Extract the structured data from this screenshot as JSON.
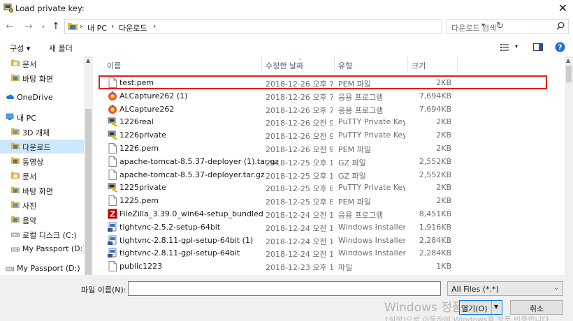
{
  "window": {
    "title": "Load private key:",
    "close": "✕"
  },
  "address": {
    "crumbs": [
      "내 PC",
      "다운로드"
    ],
    "search_placeholder": "다운로드 검색"
  },
  "toolbar": {
    "organize": "구성 ▾",
    "new_folder": "새 폴더"
  },
  "nav": [
    {
      "label": "문서",
      "icon": "document-folder-icon",
      "indent": 30
    },
    {
      "label": "바탕 화면",
      "icon": "desktop-folder-icon",
      "indent": 30
    },
    {
      "label": "OneDrive",
      "icon": "cloud-icon",
      "indent": 22
    },
    {
      "label": "내 PC",
      "icon": "computer-icon",
      "indent": 22
    },
    {
      "label": "3D 개체",
      "icon": "cube-folder-icon",
      "indent": 30
    },
    {
      "label": "다운로드",
      "icon": "download-folder-icon",
      "indent": 30,
      "selected": true
    },
    {
      "label": "동영상",
      "icon": "video-folder-icon",
      "indent": 30
    },
    {
      "label": "문서",
      "icon": "document-folder-icon",
      "indent": 30
    },
    {
      "label": "바탕 화면",
      "icon": "desktop-folder-icon",
      "indent": 30
    },
    {
      "label": "사진",
      "icon": "picture-folder-icon",
      "indent": 30
    },
    {
      "label": "음악",
      "icon": "music-folder-icon",
      "indent": 30
    },
    {
      "label": "로컬 디스크 (C:)",
      "icon": "disk-icon",
      "indent": 30
    },
    {
      "label": "My Passport (D:)",
      "icon": "drive-icon",
      "indent": 30
    },
    {
      "label": "My Passport (D:)",
      "icon": "drive-icon",
      "indent": 22
    }
  ],
  "columns": {
    "name": "이름",
    "date": "수정한 날짜",
    "type": "유형",
    "size": "크기"
  },
  "files": [
    {
      "name": "test.pem",
      "date": "2018-12-26 오후 7...",
      "type": "PEM 파일",
      "size": "2KB",
      "icon": "file-icon"
    },
    {
      "name": "ALCapture262 (1)",
      "date": "2018-12-26 오후 7...",
      "type": "응용 프로그램",
      "size": "7,694KB",
      "icon": "app-icon"
    },
    {
      "name": "ALCapture262",
      "date": "2018-12-26 오후 7...",
      "type": "응용 프로그램",
      "size": "7,694KB",
      "icon": "app-icon"
    },
    {
      "name": "1226real",
      "date": "2018-12-26 오전 9...",
      "type": "PuTTY Private Key...",
      "size": "2KB",
      "icon": "putty-key-icon"
    },
    {
      "name": "1226private",
      "date": "2018-12-26 오전 9...",
      "type": "PuTTY Private Key...",
      "size": "2KB",
      "icon": "putty-key-icon"
    },
    {
      "name": "1226.pem",
      "date": "2018-12-26 오전 9...",
      "type": "PEM 파일",
      "size": "2KB",
      "icon": "file-icon"
    },
    {
      "name": "apache-tomcat-8.5.37-deployer (1).tar.gz",
      "date": "2018-12-25 오후 1...",
      "type": "GZ 파일",
      "size": "2,552KB",
      "icon": "file-icon"
    },
    {
      "name": "apache-tomcat-8.5.37-deployer.tar.gz",
      "date": "2018-12-25 오후 1...",
      "type": "GZ 파일",
      "size": "2,552KB",
      "icon": "file-icon"
    },
    {
      "name": "1225private",
      "date": "2018-12-25 오후 8...",
      "type": "PuTTY Private Key...",
      "size": "2KB",
      "icon": "putty-key-icon"
    },
    {
      "name": "1225.pem",
      "date": "2018-12-25 오후 8...",
      "type": "PEM 파일",
      "size": "2KB",
      "icon": "file-icon"
    },
    {
      "name": "FileZilla_3.39.0_win64-setup_bundled",
      "date": "2018-12-24 오전 1...",
      "type": "응용 프로그램",
      "size": "8,451KB",
      "icon": "filezilla-icon"
    },
    {
      "name": "tightvnc-2.5.2-setup-64bit",
      "date": "2018-12-24 오전 1...",
      "type": "Windows Installer...",
      "size": "1,916KB",
      "icon": "installer-icon"
    },
    {
      "name": "tightvnc-2.8.11-gpl-setup-64bit (1)",
      "date": "2018-12-24 오전 1...",
      "type": "Windows Installer...",
      "size": "2,284KB",
      "icon": "installer-icon"
    },
    {
      "name": "tightvnc-2.8.11-gpl-setup-64bit",
      "date": "2018-12-24 오전 1...",
      "type": "Windows Installer...",
      "size": "2,284KB",
      "icon": "installer-icon"
    },
    {
      "name": "public1223",
      "date": "2018-12-23 오후 1...",
      "type": "파일",
      "size": "1KB",
      "icon": "file-icon"
    }
  ],
  "bottom": {
    "filename_label": "파일 이름(N):",
    "filename_value": "",
    "filetype": "All Files (*.*)",
    "open": "열기(O)",
    "cancel": "취소",
    "watermark1": "Windows 정품 인증",
    "watermark2": "[설정]으로 이동하여 Windows를 정품 인증합니다."
  },
  "colors": {
    "accent": "#0078d7",
    "selection": "#cce8ff",
    "highlight_box": "#e0201c"
  }
}
